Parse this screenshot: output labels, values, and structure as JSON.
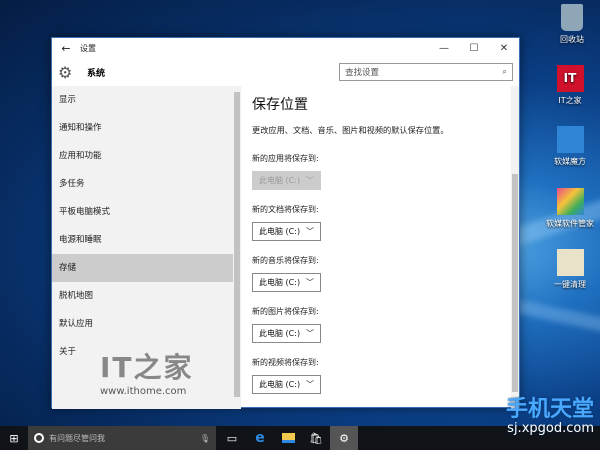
{
  "desktop": {
    "icons": [
      {
        "label": "回收站",
        "icon": "recycle-bin-icon",
        "color": "#8fa6b8"
      },
      {
        "label": "IT之家",
        "icon": "ithome-icon",
        "color": "#d0112b"
      },
      {
        "label": "软媒魔方",
        "icon": "ruanmei-mofang-icon",
        "color": "#2f86d6"
      },
      {
        "label": "软媒软件管家",
        "icon": "software-manager-icon",
        "color": "#3fae5a"
      },
      {
        "label": "一键清理",
        "icon": "cleanup-icon",
        "color": "#e8e2c8"
      }
    ]
  },
  "window": {
    "title": "设置",
    "back": "←",
    "minimize": "—",
    "maximize": "☐",
    "close": "✕",
    "section": "系统",
    "search_placeholder": "查找设置"
  },
  "sidebar": {
    "items": [
      {
        "label": "显示"
      },
      {
        "label": "通知和操作"
      },
      {
        "label": "应用和功能"
      },
      {
        "label": "多任务"
      },
      {
        "label": "平板电脑模式"
      },
      {
        "label": "电源和睡眠"
      },
      {
        "label": "存储",
        "selected": true
      },
      {
        "label": "脱机地图"
      },
      {
        "label": "默认应用"
      },
      {
        "label": "关于"
      }
    ]
  },
  "main": {
    "title": "保存位置",
    "description": "更改应用、文档、音乐、图片和视频的默认保存位置。",
    "groups": [
      {
        "label": "新的应用将保存到:",
        "value": "此电脑 (C:)",
        "disabled": true
      },
      {
        "label": "新的文档将保存到:",
        "value": "此电脑 (C:)"
      },
      {
        "label": "新的音乐将保存到:",
        "value": "此电脑 (C:)"
      },
      {
        "label": "新的图片将保存到:",
        "value": "此电脑 (C:)"
      },
      {
        "label": "新的视频将保存到:",
        "value": "此电脑 (C:)"
      }
    ]
  },
  "watermarks": {
    "ithome_logo": "IT之家",
    "ithome_url": "www.ithome.com",
    "xpgod_name": "手机天堂",
    "xpgod_url": "sj.xpgod.com"
  },
  "taskbar": {
    "search_placeholder": "有问题尽管问我"
  }
}
